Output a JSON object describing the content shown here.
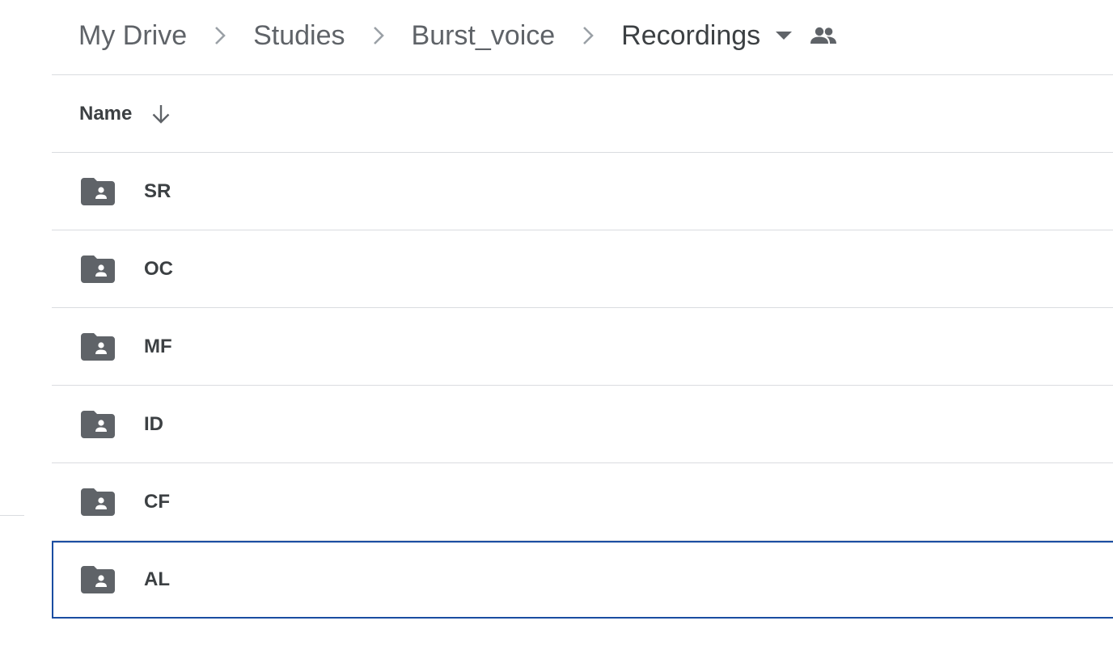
{
  "breadcrumb": {
    "items": [
      "My Drive",
      "Studies",
      "Burst_voice",
      "Recordings"
    ]
  },
  "list": {
    "name_header": "Name",
    "rows": [
      {
        "name": "SR"
      },
      {
        "name": "OC"
      },
      {
        "name": "MF"
      },
      {
        "name": "ID"
      },
      {
        "name": "CF"
      },
      {
        "name": "AL"
      }
    ],
    "selected_row": "AL"
  },
  "icons": {
    "separator": "chevron-right-icon",
    "dropdown": "arrow-drop-down-icon",
    "shared": "people-icon",
    "sort": "arrow-downward-icon",
    "folder": "shared-folder-icon"
  },
  "colors": {
    "text": "#3c4043",
    "muted": "#5f6368",
    "divider": "#dadce0",
    "selection": "#1a4da1",
    "icon": "#5f6368"
  }
}
